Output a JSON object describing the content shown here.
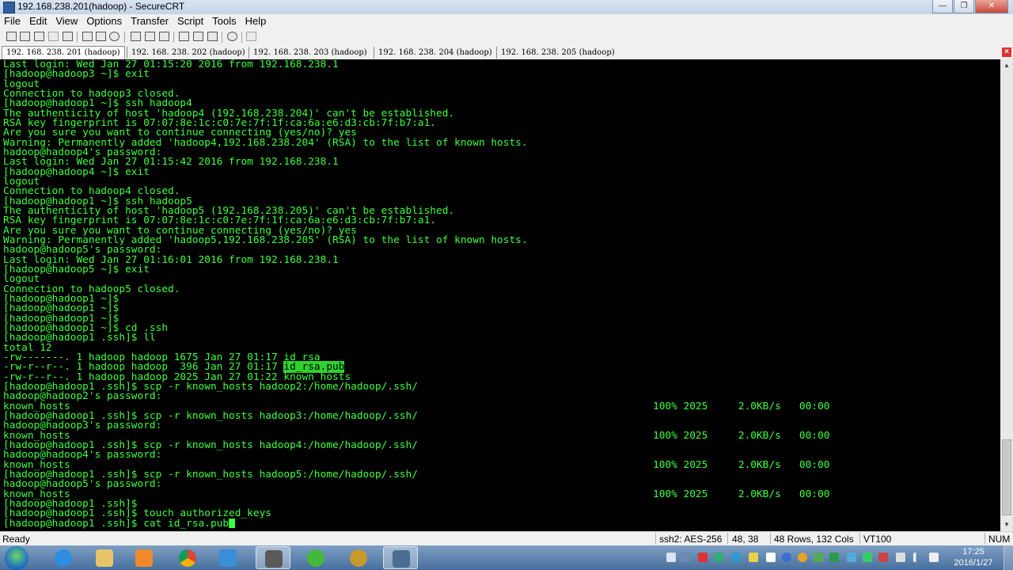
{
  "window": {
    "title": "192.168.238.201(hadoop) - SecureCRT"
  },
  "menu": [
    "File",
    "Edit",
    "View",
    "Options",
    "Transfer",
    "Script",
    "Tools",
    "Help"
  ],
  "tabs": [
    "192. 168. 238. 201 (hadoop)",
    "192. 168. 238. 202 (hadoop)",
    "192. 168. 238. 203 (hadoop)",
    "192. 168. 238. 204 (hadoop)",
    "192. 168. 238. 205 (hadoop)"
  ],
  "terminal": {
    "lines": [
      "Last login: Wed Jan 27 01:15:20 2016 from 192.168.238.1",
      "[hadoop@hadoop3 ~]$ exit",
      "logout",
      "Connection to hadoop3 closed.",
      "[hadoop@hadoop1 ~]$ ssh hadoop4",
      "The authenticity of host 'hadoop4 (192.168.238.204)' can't be established.",
      "RSA key fingerprint is 07:07:8e:1c:c0:7e:7f:1f:ca:6a:e6:d3:cb:7f:b7:a1.",
      "Are you sure you want to continue connecting (yes/no)? yes",
      "Warning: Permanently added 'hadoop4,192.168.238.204' (RSA) to the list of known hosts.",
      "hadoop@hadoop4's password:",
      "Last login: Wed Jan 27 01:15:42 2016 from 192.168.238.1",
      "[hadoop@hadoop4 ~]$ exit",
      "logout",
      "Connection to hadoop4 closed.",
      "[hadoop@hadoop1 ~]$ ssh hadoop5",
      "The authenticity of host 'hadoop5 (192.168.238.205)' can't be established.",
      "RSA key fingerprint is 07:07:8e:1c:c0:7e:7f:1f:ca:6a:e6:d3:cb:7f:b7:a1.",
      "Are you sure you want to continue connecting (yes/no)? yes",
      "Warning: Permanently added 'hadoop5,192.168.238.205' (RSA) to the list of known hosts.",
      "hadoop@hadoop5's password:",
      "Last login: Wed Jan 27 01:16:01 2016 from 192.168.238.1",
      "[hadoop@hadoop5 ~]$ exit",
      "logout",
      "Connection to hadoop5 closed.",
      "[hadoop@hadoop1 ~]$",
      "[hadoop@hadoop1 ~]$",
      "[hadoop@hadoop1 ~]$",
      "[hadoop@hadoop1 ~]$ cd .ssh",
      "[hadoop@hadoop1 .ssh]$ ll",
      "total 12",
      "-rw-------. 1 hadoop hadoop 1675 Jan 27 01:17 id_rsa",
      "-rw-r--r--. 1 hadoop hadoop  396 Jan 27 01:17 ",
      "-rw-r--r--. 1 hadoop hadoop 2025 Jan 27 01:22 known_hosts",
      "[hadoop@hadoop1 .ssh]$ scp -r known_hosts hadoop2:/home/hadoop/.ssh/",
      "hadoop@hadoop2's password:",
      "known_hosts",
      "[hadoop@hadoop1 .ssh]$ scp -r known_hosts hadoop3:/home/hadoop/.ssh/",
      "hadoop@hadoop3's password:",
      "known_hosts",
      "[hadoop@hadoop1 .ssh]$ scp -r known_hosts hadoop4:/home/hadoop/.ssh/",
      "hadoop@hadoop4's password:",
      "known_hosts",
      "[hadoop@hadoop1 .ssh]$ scp -r known_hosts hadoop5:/home/hadoop/.ssh/",
      "hadoop@hadoop5's password:",
      "known_hosts",
      "[hadoop@hadoop1 .ssh]$",
      "[hadoop@hadoop1 .ssh]$ touch authorized_keys",
      "[hadoop@hadoop1 .ssh]$ cat id_rsa.pub"
    ],
    "highlight_text": "id_rsa.pub",
    "transfer_stats": "100% 2025     2.0KB/s   00:00"
  },
  "status": {
    "ready": "Ready",
    "cipher": "ssh2: AES-256",
    "cursor_pos": "48, 38",
    "size": "48 Rows, 132 Cols",
    "emulation": "VT100",
    "num": "NUM"
  },
  "taskbar": {
    "time": "17:25",
    "date": "2016/1/27",
    "apps": [
      "internet-explorer",
      "file-explorer",
      "media-player",
      "chrome",
      "browser",
      "security-app",
      "refresh-app",
      "winrar",
      "securecrt"
    ]
  }
}
